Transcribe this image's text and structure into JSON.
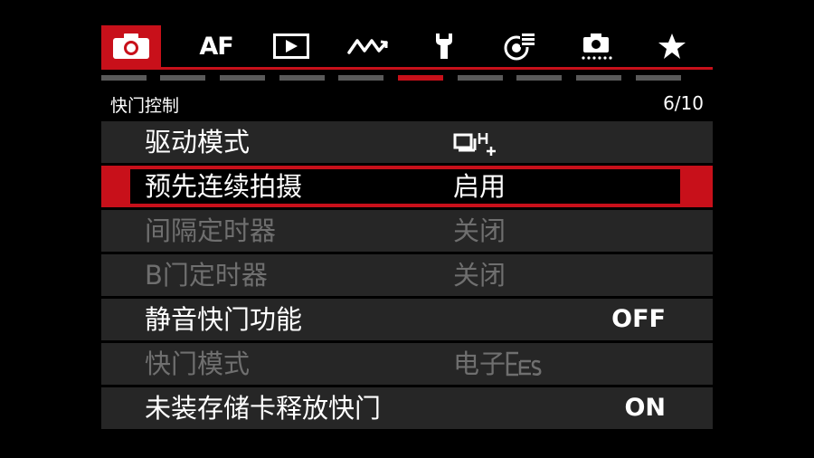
{
  "tabs": [
    {
      "icon": "camera-icon",
      "active": true
    },
    {
      "icon": "af-icon",
      "text": "AF",
      "active": false
    },
    {
      "icon": "playback-icon",
      "active": false
    },
    {
      "icon": "wireless-icon",
      "active": false
    },
    {
      "icon": "wrench-icon",
      "active": false
    },
    {
      "icon": "custom-function-icon",
      "active": false
    },
    {
      "icon": "dust-delete-icon",
      "active": false
    },
    {
      "icon": "star-icon",
      "active": false
    }
  ],
  "page_indicator": {
    "segments": 10,
    "active_index": 5
  },
  "header": {
    "title": "快门控制",
    "page": "6/10"
  },
  "rows": [
    {
      "label": "驱动模式",
      "value_icon": "drive-mode-icon",
      "state": "normal"
    },
    {
      "label": "预先连续拍摄",
      "value": "启用",
      "state": "selected"
    },
    {
      "label": "间隔定时器",
      "value": "关闭",
      "state": "disabled"
    },
    {
      "label": "B门定时器",
      "value": "关闭",
      "state": "disabled"
    },
    {
      "label": "静音快门功能",
      "value": "OFF",
      "state": "normal"
    },
    {
      "label": "快门模式",
      "value": "电子",
      "value_icon": "electronic-shutter-icon",
      "state": "disabled"
    },
    {
      "label": "未装存储卡释放快门",
      "value": "ON",
      "state": "normal"
    }
  ],
  "colors": {
    "accent": "#c8101a",
    "row_bg": "#262626",
    "disabled": "#6f6f6f"
  }
}
